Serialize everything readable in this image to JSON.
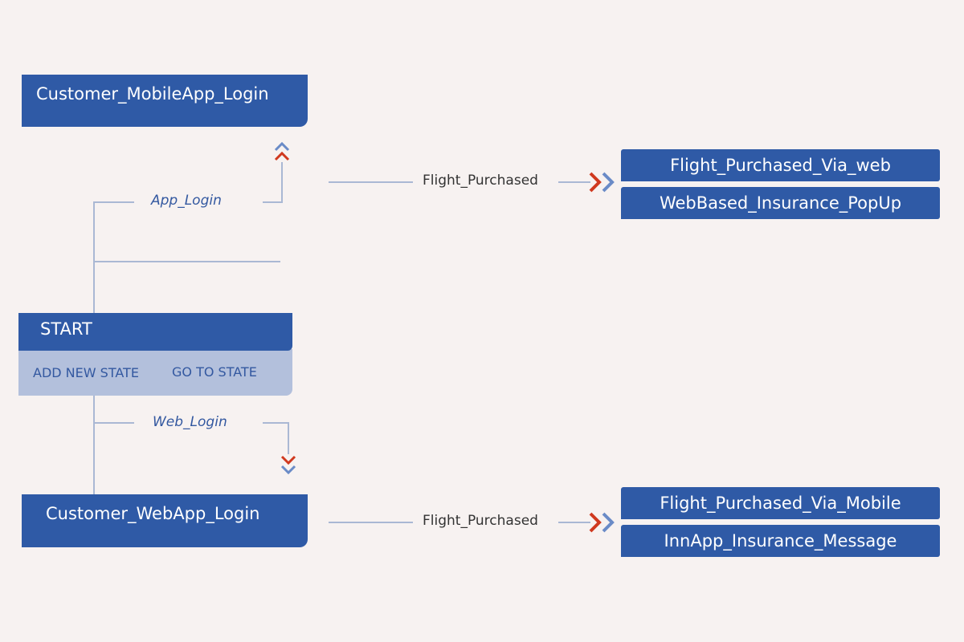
{
  "states": {
    "mobile_login": "Customer_MobileApp_Login",
    "start": "START",
    "web_login": "Customer_WebApp_Login"
  },
  "start_actions": {
    "add_new_state": "ADD NEW STATE",
    "go_to_state": "GO TO STATE"
  },
  "transitions": {
    "app_login": "App_Login",
    "web_login": "Web_Login"
  },
  "flows": [
    {
      "event": "Flight_Purchased",
      "results": [
        "Flight_Purchased_Via_web",
        "WebBased_Insurance_PopUp"
      ]
    },
    {
      "event": "Flight_Purchased",
      "results": [
        "Flight_Purchased_Via_Mobile",
        "InnApp_Insurance_Message"
      ]
    }
  ],
  "colors": {
    "background": "#f7f2f1",
    "state_blue": "#2f5aa6",
    "actions_panel": "#b3c0dc",
    "connector": "#aab8d4",
    "chevron_red": "#d0391f",
    "chevron_blue": "#6a8bc7"
  },
  "icons": [
    "double-chevron-up-icon",
    "double-chevron-down-icon",
    "double-chevron-right-icon"
  ]
}
